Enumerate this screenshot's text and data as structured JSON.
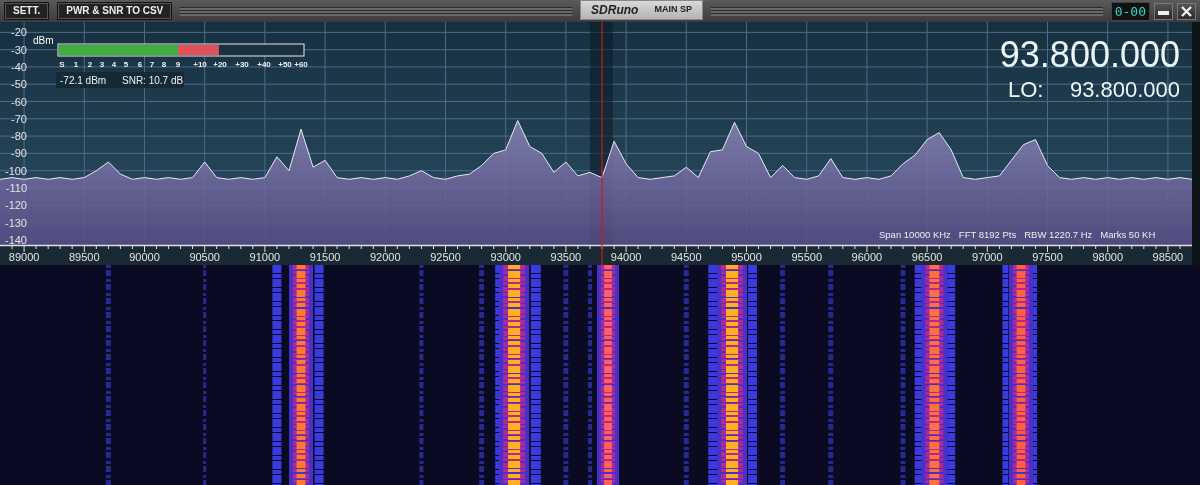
{
  "toolbar": {
    "buttons": [
      "SETT.",
      "PWR & SNR TO CSV"
    ]
  },
  "panel_tab": {
    "logo": "SDRuno",
    "label": "MAIN SP"
  },
  "window_controls": {
    "counter": "0-00"
  },
  "spectrum": {
    "unit": "dBm",
    "chart_data": {
      "type": "area",
      "grid": true,
      "xlim": [
        88800,
        98700
      ],
      "ylim": [
        -143,
        -14
      ],
      "bands": [
        {
          "axis": "x",
          "from": 93700,
          "to": 93890,
          "color": "#0a1a24"
        }
      ],
      "ref_lines": [
        {
          "axis": "x",
          "value": 93800,
          "color": "#d01818"
        }
      ],
      "yticks": [
        -20,
        -30,
        -40,
        -50,
        -60,
        -70,
        -80,
        -90,
        -100,
        -110,
        -120,
        -130,
        -140
      ],
      "xticks": [
        89000,
        89500,
        90000,
        90500,
        91000,
        91500,
        92000,
        92500,
        93000,
        93500,
        94000,
        94500,
        95000,
        95500,
        96000,
        96500,
        97000,
        97500,
        98000,
        98500
      ],
      "x": [
        88800,
        88900,
        89000,
        89100,
        89200,
        89300,
        89400,
        89500,
        89600,
        89700,
        89800,
        89900,
        90000,
        90100,
        90200,
        90300,
        90400,
        90500,
        90600,
        90700,
        90800,
        90900,
        91000,
        91100,
        91200,
        91300,
        91400,
        91500,
        91600,
        91700,
        91800,
        91900,
        92000,
        92100,
        92200,
        92300,
        92400,
        92500,
        92600,
        92700,
        92800,
        92900,
        93000,
        93100,
        93200,
        93300,
        93400,
        93500,
        93600,
        93700,
        93800,
        93900,
        94000,
        94100,
        94200,
        94300,
        94400,
        94500,
        94600,
        94700,
        94800,
        94900,
        95000,
        95100,
        95200,
        95300,
        95400,
        95500,
        95600,
        95700,
        95800,
        95900,
        96000,
        96100,
        96200,
        96300,
        96400,
        96500,
        96600,
        96700,
        96800,
        96900,
        97000,
        97100,
        97200,
        97300,
        97400,
        97500,
        97600,
        97700,
        97800,
        97900,
        98000,
        98100,
        98200,
        98300,
        98400,
        98500,
        98600,
        98700
      ],
      "series": [
        {
          "color": "#e8e8f4",
          "values": [
            -105,
            -104,
            -105,
            -104,
            -105,
            -104,
            -105,
            -104,
            -100,
            -95,
            -102,
            -105,
            -104,
            -105,
            -104,
            -105,
            -104,
            -95,
            -104,
            -105,
            -104,
            -105,
            -104,
            -92,
            -100,
            -76,
            -98,
            -94,
            -104,
            -105,
            -104,
            -105,
            -104,
            -105,
            -103,
            -100,
            -104,
            -105,
            -103,
            -102,
            -97,
            -90,
            -88,
            -71,
            -86,
            -90,
            -101,
            -95,
            -103,
            -101,
            -104,
            -83,
            -96,
            -104,
            -105,
            -104,
            -103,
            -98,
            -104,
            -89,
            -88,
            -72,
            -86,
            -90,
            -104,
            -97,
            -104,
            -105,
            -103,
            -93,
            -104,
            -105,
            -104,
            -105,
            -103,
            -96,
            -91,
            -82,
            -78,
            -88,
            -104,
            -105,
            -104,
            -103,
            -94,
            -85,
            -82,
            -97,
            -104,
            -105,
            -104,
            -105,
            -104,
            -105,
            -104,
            -105,
            -104,
            -105,
            -104,
            -105
          ]
        }
      ]
    },
    "s_meter": {
      "level": 0.654,
      "scale": [
        "S",
        "1",
        "2",
        "3",
        "4",
        "5",
        "6",
        "7",
        "8",
        "9",
        "+10",
        "+20",
        "+30",
        "+40",
        "+50",
        "+60"
      ],
      "power": "-72.1 dBm",
      "snr": "SNR: 10.7 dB"
    },
    "frequency": "93.800.000",
    "lo_label": "LO:",
    "lo_frequency": "93.800.000",
    "info": [
      "Span 10000 KHz",
      "FFT 8192 Pts",
      "RBW 1220.7 Hz",
      "Marks 50 KH"
    ]
  }
}
